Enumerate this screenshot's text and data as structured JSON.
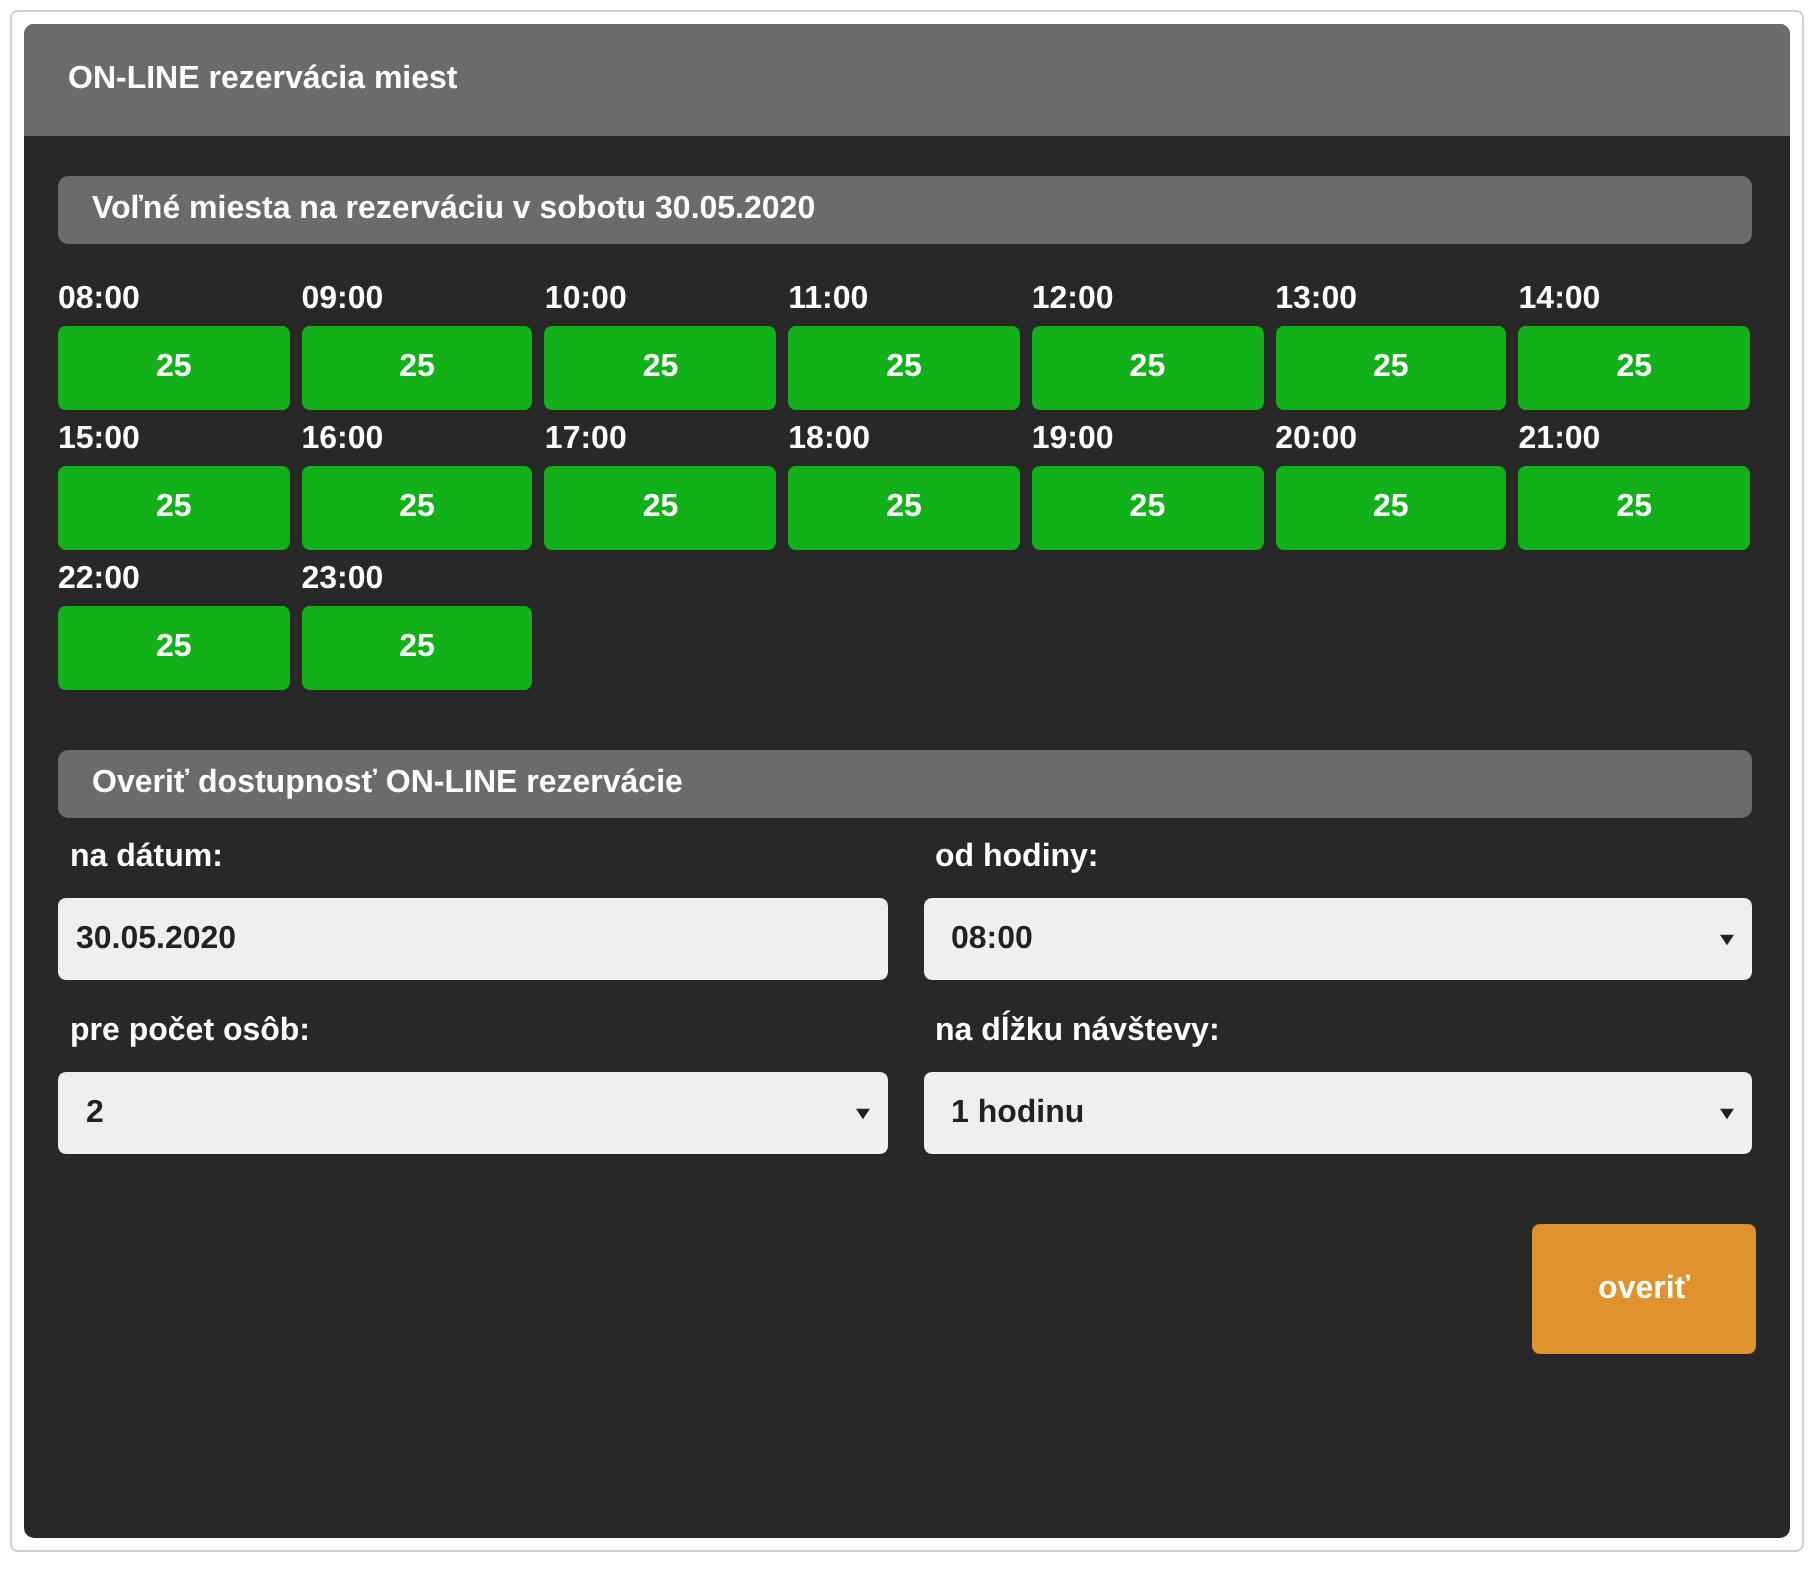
{
  "panel": {
    "title": "ON-LINE rezervácia miest"
  },
  "availability": {
    "heading": "Voľné miesta na rezerváciu v sobotu 30.05.2020",
    "slots": [
      {
        "time": "08:00",
        "free": "25"
      },
      {
        "time": "09:00",
        "free": "25"
      },
      {
        "time": "10:00",
        "free": "25"
      },
      {
        "time": "11:00",
        "free": "25"
      },
      {
        "time": "12:00",
        "free": "25"
      },
      {
        "time": "13:00",
        "free": "25"
      },
      {
        "time": "14:00",
        "free": "25"
      },
      {
        "time": "15:00",
        "free": "25"
      },
      {
        "time": "16:00",
        "free": "25"
      },
      {
        "time": "17:00",
        "free": "25"
      },
      {
        "time": "18:00",
        "free": "25"
      },
      {
        "time": "19:00",
        "free": "25"
      },
      {
        "time": "20:00",
        "free": "25"
      },
      {
        "time": "21:00",
        "free": "25"
      },
      {
        "time": "22:00",
        "free": "25"
      },
      {
        "time": "23:00",
        "free": "25"
      }
    ]
  },
  "check": {
    "heading": "Overiť dostupnosť ON-LINE rezervácie",
    "fields": [
      {
        "kind": "text",
        "label": "na dátum:",
        "value": "30.05.2020"
      },
      {
        "kind": "select",
        "label": "od hodiny:",
        "value": "08:00"
      },
      {
        "kind": "select",
        "label": "pre počet osôb:",
        "value": "2"
      },
      {
        "kind": "select",
        "label": "na dĺžku návštevy:",
        "value": "1 hodinu"
      }
    ],
    "button": "overiť"
  }
}
